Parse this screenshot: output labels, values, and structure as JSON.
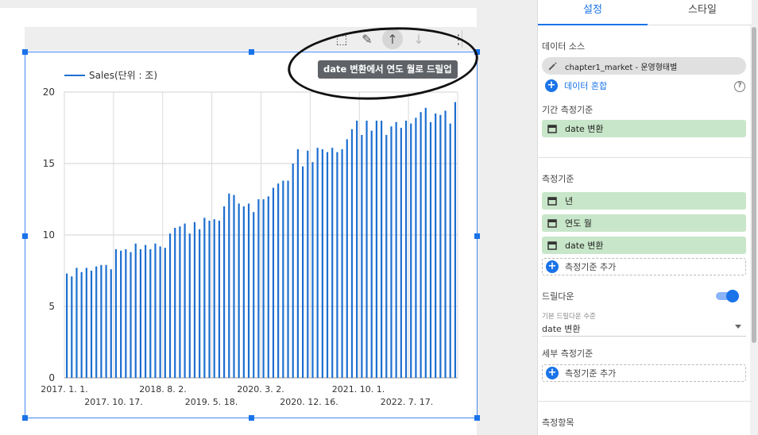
{
  "toolbar": {
    "buttons": [
      {
        "name": "select-area-icon",
        "glyph": "⬚"
      },
      {
        "name": "pencil-icon",
        "glyph": "✎"
      },
      {
        "name": "arrow-up-icon",
        "glyph": "↑"
      },
      {
        "name": "arrow-down-icon",
        "glyph": "↓"
      },
      {
        "name": "more-vert-icon",
        "glyph": "⋮"
      }
    ],
    "tooltip": "date 변환에서 연도 월로 드릴업"
  },
  "chart_data": {
    "type": "bar",
    "series": [
      {
        "name": "Sales(단위 : 조)",
        "color": "#1e6fd0"
      }
    ],
    "ylim": [
      0,
      20
    ],
    "yticks": [
      0,
      5,
      10,
      15,
      20
    ],
    "xticks_row1": [
      "2017. 1. 1.",
      "2018. 8. 2.",
      "2020. 3. 2.",
      "2021. 10. 1."
    ],
    "xticks_row2": [
      "2017. 10. 17.",
      "2019. 5. 18.",
      "2020. 12. 16.",
      "2022. 7. 17."
    ],
    "values": [
      7.3,
      7.1,
      7.7,
      7.4,
      7.7,
      7.5,
      7.8,
      7.9,
      7.9,
      7.6,
      9.0,
      8.9,
      9.0,
      8.8,
      9.4,
      9.0,
      9.3,
      9.0,
      9.4,
      9.2,
      9.1,
      10.1,
      10.5,
      10.6,
      10.8,
      10.1,
      10.9,
      10.4,
      11.2,
      11.0,
      11.1,
      11.0,
      12.0,
      12.9,
      12.8,
      12.2,
      12.0,
      12.2,
      11.6,
      12.5,
      12.5,
      12.7,
      13.3,
      13.6,
      13.8,
      13.8,
      15.0,
      16.0,
      14.8,
      15.9,
      15.1,
      16.1,
      16.0,
      15.8,
      16.1,
      15.8,
      16.0,
      16.7,
      17.4,
      18.0,
      17.0,
      18.0,
      17.3,
      18.0,
      18.0,
      17.0,
      17.6,
      17.9,
      17.5,
      18.0,
      17.8,
      18.2,
      18.6,
      18.9,
      17.9,
      18.5,
      18.4,
      18.7,
      17.8,
      19.3
    ]
  },
  "panel": {
    "tabs": [
      "설정",
      "스타일"
    ],
    "data_source_label": "데이터 소스",
    "data_source_value": "chapter1_market - 운영형태별",
    "blend_label": "데이터 혼합",
    "date_range_label": "기간 측정기준",
    "date_range_value": "date 변환",
    "dimension_label": "측정기준",
    "dimensions": [
      "년",
      "연도 월",
      "date 변환"
    ],
    "add_dimension": "측정기준 추가",
    "drilldown_label": "드릴다운",
    "default_drill_label": "기본 드릴다운 수준",
    "default_drill_value": "date 변환",
    "breakdown_label": "세부 측정기준",
    "add_breakdown": "측정기준 추가",
    "metric_label": "측정항목",
    "drilldown_enabled": true,
    "accent": "#1a73e8",
    "chip_green": "#c8e6c9"
  }
}
